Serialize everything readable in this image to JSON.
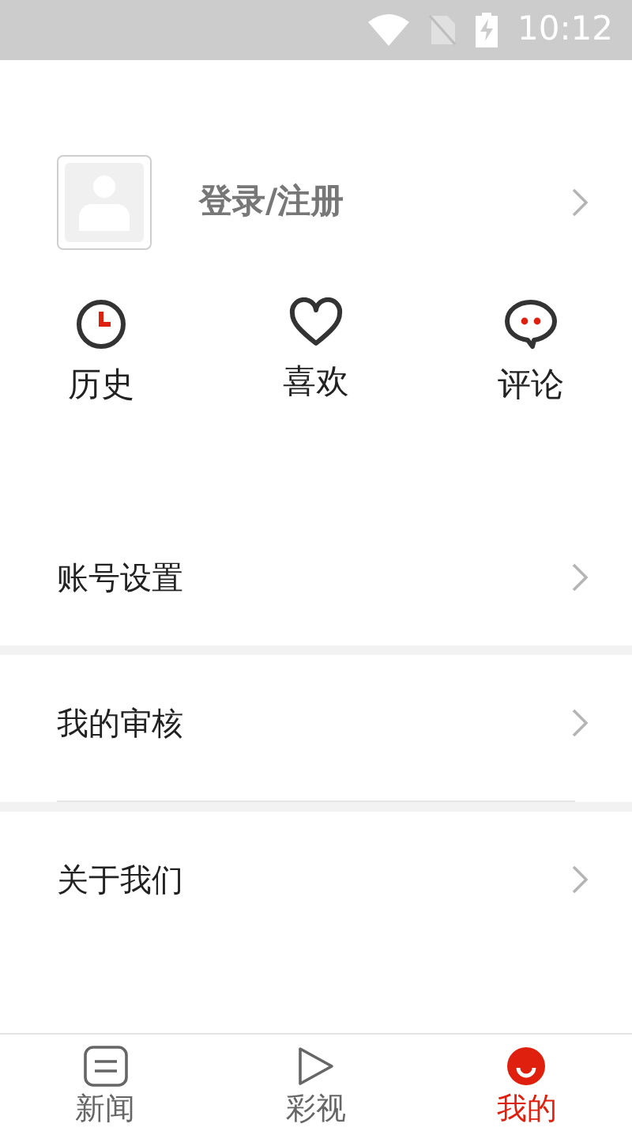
{
  "status_bar": {
    "time": "10:12"
  },
  "profile": {
    "label": "登录/注册"
  },
  "shortcuts": [
    {
      "kind": "history",
      "label": "历史"
    },
    {
      "kind": "like",
      "label": "喜欢"
    },
    {
      "kind": "comment",
      "label": "评论"
    }
  ],
  "menu_groups": [
    [
      {
        "label": "账号设置"
      }
    ],
    [
      {
        "label": "我的审核"
      }
    ],
    [
      {
        "label": "关于我们"
      }
    ]
  ],
  "tab_bar": [
    {
      "kind": "news",
      "label": "新闻",
      "selected": false
    },
    {
      "kind": "video",
      "label": "彩视",
      "selected": false
    },
    {
      "kind": "me",
      "label": "我的",
      "selected": true
    }
  ]
}
